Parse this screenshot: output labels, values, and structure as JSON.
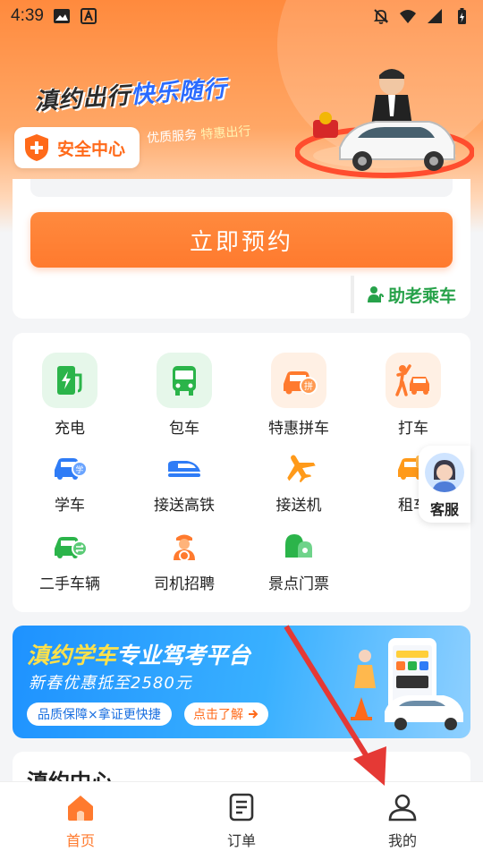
{
  "status_bar": {
    "time": "4:39"
  },
  "hero": {
    "title_part1": "滇约出行",
    "title_part2": "快乐随行",
    "sub_prefix": "优质服务",
    "sub_highlight": "特惠出行"
  },
  "safety_center": {
    "label": "安全中心"
  },
  "booking": {
    "reserve_label": "立即预约",
    "elderly_label": "助老乘车"
  },
  "services": [
    {
      "label": "充电",
      "icon": "charging-station-icon",
      "color": "#2bb44a"
    },
    {
      "label": "包车",
      "icon": "bus-icon",
      "color": "#2bb44a"
    },
    {
      "label": "特惠拼车",
      "icon": "carpool-icon",
      "color": "#ff7a2e"
    },
    {
      "label": "打车",
      "icon": "hail-taxi-icon",
      "color": "#ff7a2e"
    },
    {
      "label": "学车",
      "icon": "driving-school-icon",
      "color": "#2f7cf6"
    },
    {
      "label": "接送高铁",
      "icon": "high-speed-train-icon",
      "color": "#2f7cf6"
    },
    {
      "label": "接送机",
      "icon": "airplane-icon",
      "color": "#ff9a1a"
    },
    {
      "label": "租车",
      "icon": "car-rental-icon",
      "color": "#ff9a1a"
    },
    {
      "label": "二手车辆",
      "icon": "used-car-icon",
      "color": "#2bb44a"
    },
    {
      "label": "司机招聘",
      "icon": "driver-recruit-icon",
      "color": "#ff7a2e"
    },
    {
      "label": "景点门票",
      "icon": "scenic-ticket-icon",
      "color": "#2bb44a"
    }
  ],
  "customer_service": {
    "label": "客服"
  },
  "promo": {
    "title_part1": "滇约学车",
    "title_part2": "专业驾考平台",
    "subtitle": "新春优惠抵至2580元",
    "pill": "品质保障×拿证更快捷",
    "cta": "点击了解"
  },
  "section": {
    "title": "滇约中心"
  },
  "bottom_nav": [
    {
      "label": "首页",
      "icon": "home-icon",
      "active": true
    },
    {
      "label": "订单",
      "icon": "order-list-icon",
      "active": false
    },
    {
      "label": "我的",
      "icon": "profile-icon",
      "active": false
    }
  ],
  "colors": {
    "brand_orange": "#ff7a2e",
    "green": "#27a24a",
    "blue": "#1e92ff",
    "annotation_red": "#e53935"
  }
}
